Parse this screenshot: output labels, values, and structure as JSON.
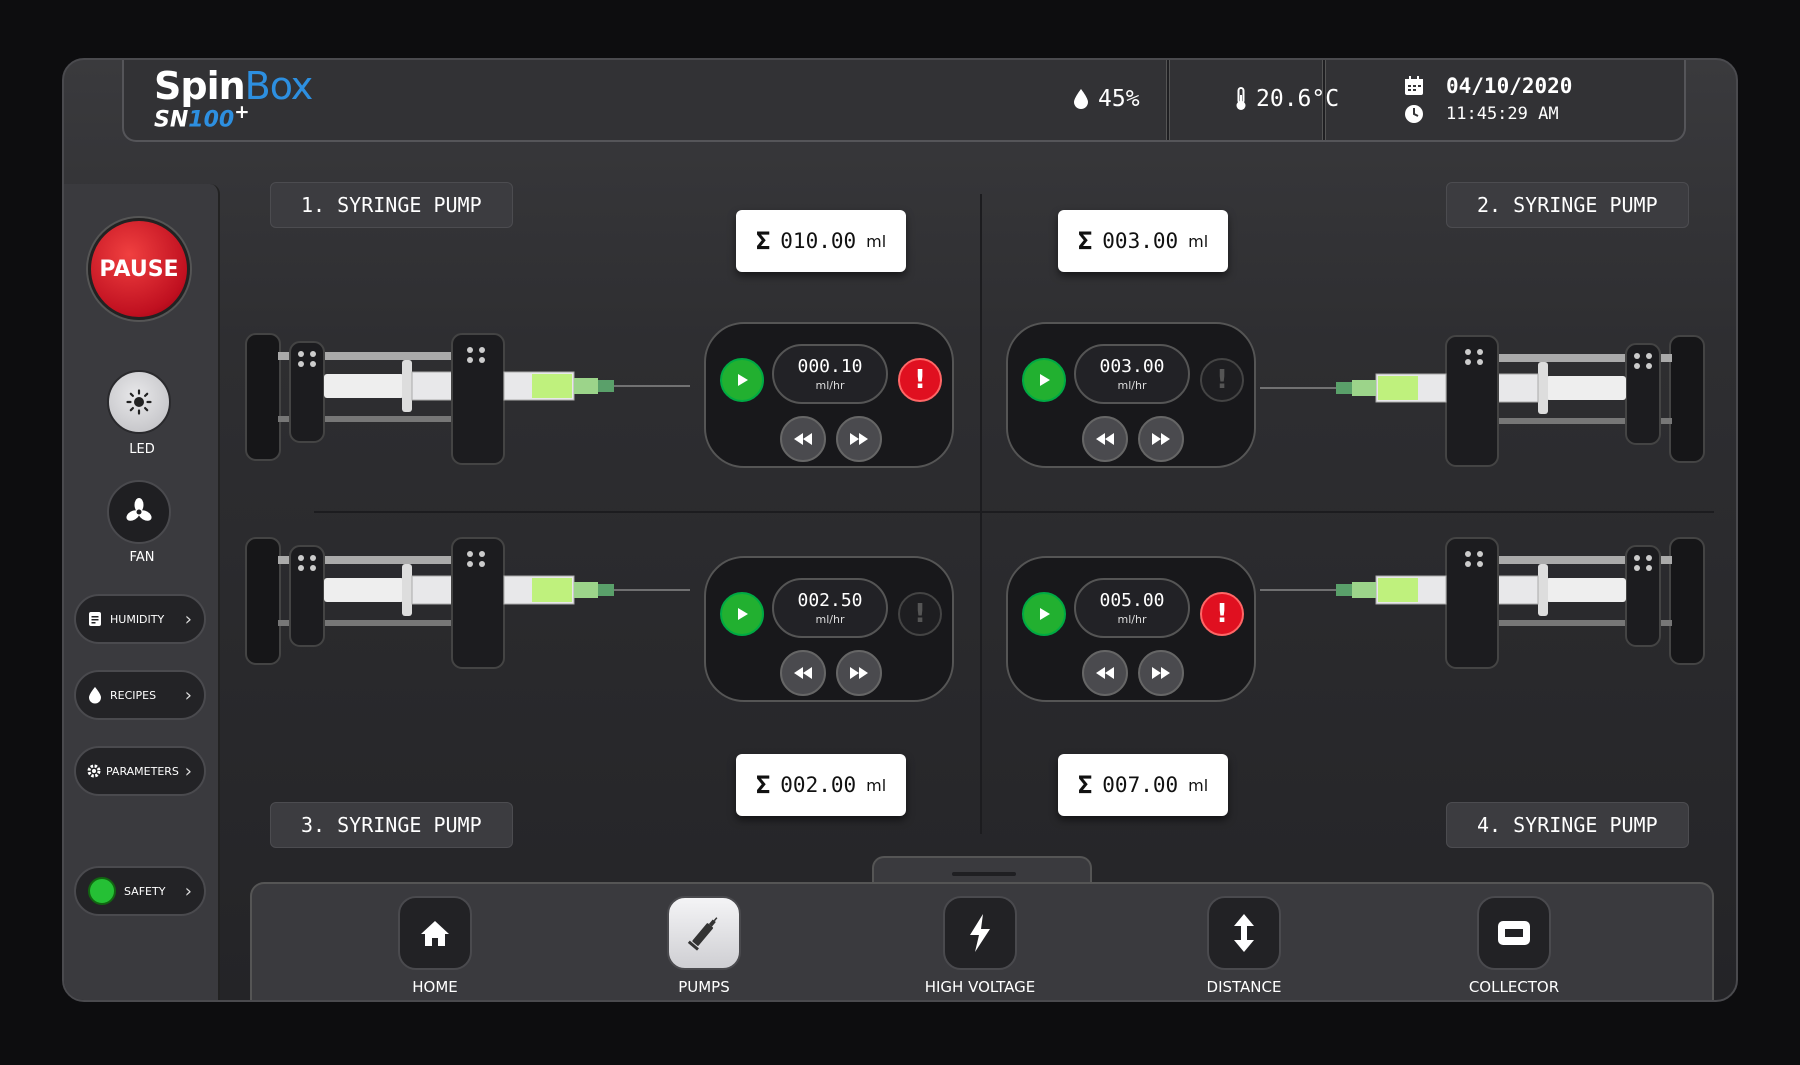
{
  "header": {
    "brand_a": "Spin",
    "brand_b": "Box",
    "model_a": "SN",
    "model_b": "100",
    "model_c": "+",
    "humidity": "45%",
    "temperature": "20.6°C",
    "date": "04/10/2020",
    "time": "11:45:29 AM"
  },
  "sidebar": {
    "pause": "PAUSE",
    "led": "LED",
    "fan": "FAN",
    "humidity": "HUMIDITY",
    "recipes": "RECIPES",
    "parameters": "PARAMETERS",
    "safety": "SAFETY"
  },
  "pumps": [
    {
      "label": "1. SYRINGE PUMP",
      "total": "010.00",
      "rate": "000.10",
      "alert": true
    },
    {
      "label": "2. SYRINGE PUMP",
      "total": "003.00",
      "rate": "003.00",
      "alert": false
    },
    {
      "label": "3. SYRINGE PUMP",
      "total": "002.00",
      "rate": "002.50",
      "alert": false
    },
    {
      "label": "4. SYRINGE PUMP",
      "total": "007.00",
      "rate": "005.00",
      "alert": true
    }
  ],
  "units": {
    "total": "ml",
    "rate": "ml/hr",
    "sigma": "Σ",
    "alert": "!"
  },
  "nav": {
    "home": "HOME",
    "pumps": "PUMPS",
    "high_voltage": "HIGH VOLTAGE",
    "distance": "DISTANCE",
    "collector": "COLLECTOR"
  },
  "colors": {
    "accent": "#2d8fe0",
    "pause": "#d01020",
    "play": "#22b030",
    "safety": "#25c035"
  }
}
